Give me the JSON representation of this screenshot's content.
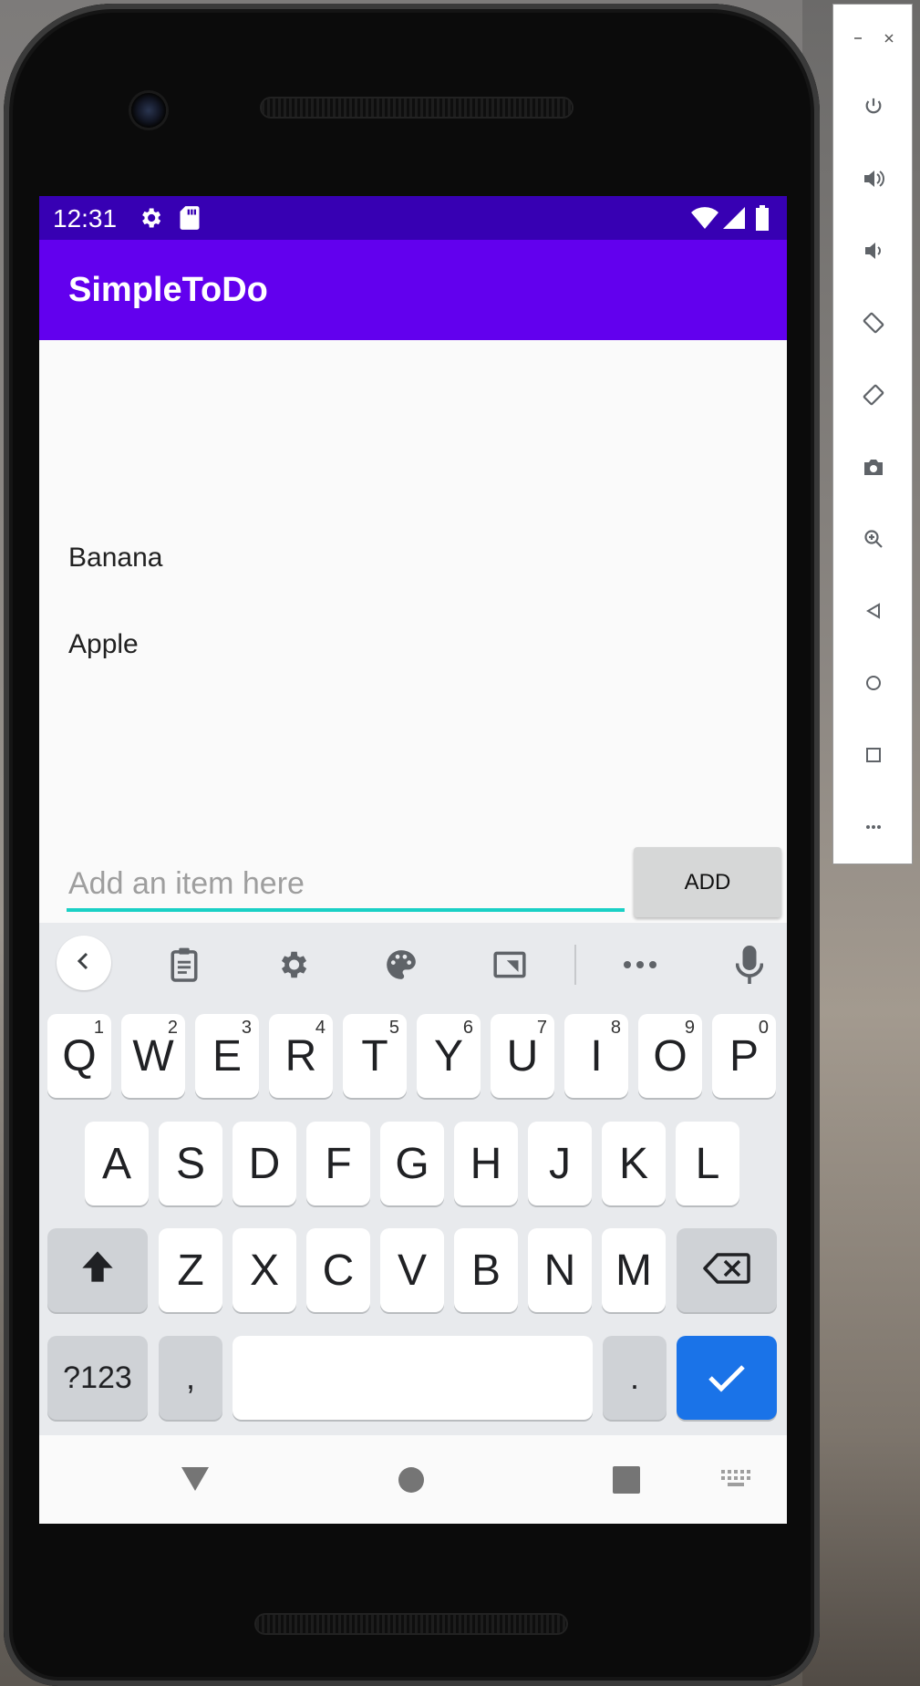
{
  "status_bar": {
    "time": "12:31"
  },
  "app": {
    "title": "SimpleToDo"
  },
  "list": {
    "items": [
      "Banana",
      "Apple"
    ]
  },
  "input": {
    "placeholder": "Add an item here",
    "value": ""
  },
  "add_button": {
    "label": "ADD"
  },
  "keyboard": {
    "row1": [
      {
        "key": "Q",
        "sup": "1"
      },
      {
        "key": "W",
        "sup": "2"
      },
      {
        "key": "E",
        "sup": "3"
      },
      {
        "key": "R",
        "sup": "4"
      },
      {
        "key": "T",
        "sup": "5"
      },
      {
        "key": "Y",
        "sup": "6"
      },
      {
        "key": "U",
        "sup": "7"
      },
      {
        "key": "I",
        "sup": "8"
      },
      {
        "key": "O",
        "sup": "9"
      },
      {
        "key": "P",
        "sup": "0"
      }
    ],
    "row2": [
      "A",
      "S",
      "D",
      "F",
      "G",
      "H",
      "J",
      "K",
      "L"
    ],
    "row3": [
      "Z",
      "X",
      "C",
      "V",
      "B",
      "N",
      "M"
    ],
    "symbols_label": "?123",
    "comma_label": ",",
    "period_label": "."
  },
  "colors": {
    "status_bar": "#3700b3",
    "app_bar": "#6200ee",
    "input_underline": "#1ad0c5",
    "enter_key": "#1a73e8"
  },
  "side_panel": {
    "icons": [
      "power-icon",
      "volume-up-icon",
      "volume-down-icon",
      "rotate-left-icon",
      "rotate-right-icon",
      "camera-icon",
      "zoom-icon",
      "back-icon",
      "home-icon",
      "overview-icon",
      "more-icon"
    ]
  }
}
